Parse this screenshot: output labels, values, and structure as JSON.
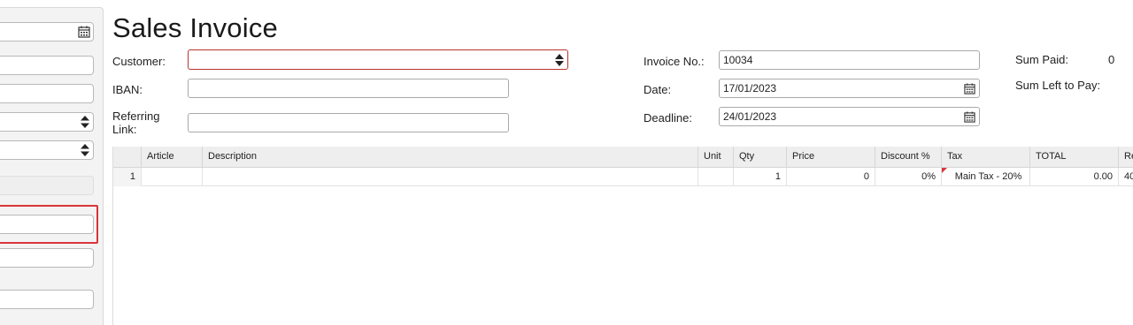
{
  "title": "Sales Invoice",
  "form": {
    "customer_label": "Customer:",
    "customer_value": "",
    "iban_label": "IBAN:",
    "iban_value": "",
    "referring_link_label_1": "Referring",
    "referring_link_label_2": "Link:",
    "referring_link_value": "",
    "invoice_no_label": "Invoice No.:",
    "invoice_no_value": "10034",
    "date_label": "Date:",
    "date_value": "17/01/2023",
    "deadline_label": "Deadline:",
    "deadline_value": "24/01/2023"
  },
  "summary": {
    "sum_paid_label": "Sum Paid:",
    "sum_paid_value": "0",
    "sum_left_label": "Sum Left to Pay:"
  },
  "grid": {
    "columns": [
      "Article",
      "Description",
      "Unit",
      "Qty",
      "Price",
      "Discount %",
      "Tax",
      "TOTAL",
      "Re"
    ],
    "rows": [
      {
        "num": "1",
        "article": "",
        "description": "",
        "unit": "",
        "qty": "1",
        "price": "0",
        "discount": "0%",
        "tax": "Main Tax - 20%",
        "total": "0.00",
        "re": "40"
      }
    ]
  },
  "colors": {
    "error_border": "#b8342e",
    "highlight": "#d9353a",
    "header_bg": "#eeeeee"
  },
  "icons": [
    "calendar-icon",
    "spinner-arrows-icon"
  ]
}
